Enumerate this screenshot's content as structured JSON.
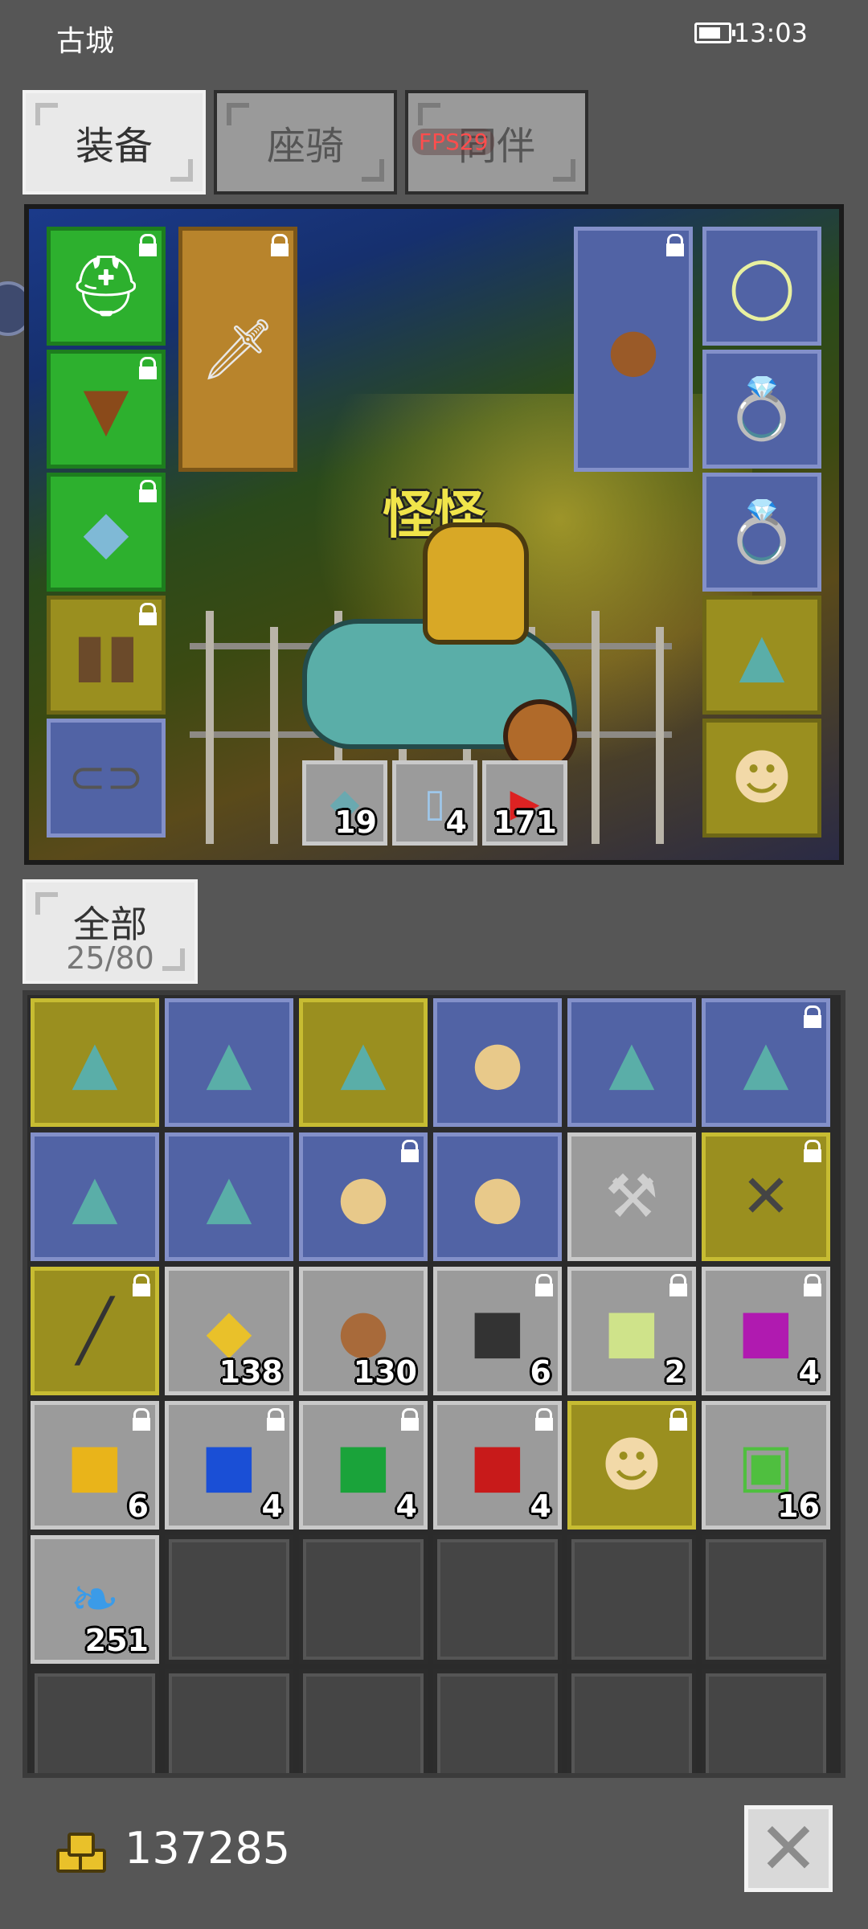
{
  "status_bar": {
    "location": "古城",
    "time": "13:03"
  },
  "tabs": [
    {
      "label": "装备",
      "active": true
    },
    {
      "label": "座骑",
      "active": false
    },
    {
      "label": "同伴",
      "active": false
    }
  ],
  "fps_label": "FPS29",
  "hero": {
    "name": "怪怪"
  },
  "equipment_slots": [
    {
      "name": "helmet-slot",
      "icon": "golden-helmet",
      "locked": true,
      "color": "green"
    },
    {
      "name": "armor-slot",
      "icon": "leather-armor",
      "locked": true,
      "color": "green"
    },
    {
      "name": "gloves-slot",
      "icon": "blue-bracer",
      "locked": true,
      "color": "green"
    },
    {
      "name": "boots-slot",
      "icon": "leather-boots",
      "locked": true,
      "color": "olive"
    },
    {
      "name": "belt-slot",
      "icon": "belt",
      "locked": false,
      "color": "blue"
    },
    {
      "name": "weapon-slot",
      "icon": "sword",
      "locked": true,
      "color": "brown"
    },
    {
      "name": "shield-slot",
      "icon": "round-shield",
      "locked": true,
      "color": "blue"
    },
    {
      "name": "amulet-slot",
      "icon": "amulet",
      "locked": false,
      "color": "blue"
    },
    {
      "name": "ring-slot-1",
      "icon": "emerald-ring",
      "locked": false,
      "color": "blue"
    },
    {
      "name": "ring-slot-2",
      "icon": "onyx-ring",
      "locked": false,
      "color": "blue"
    },
    {
      "name": "mount-slot",
      "icon": "dragon-mount-card",
      "locked": false,
      "color": "olive"
    },
    {
      "name": "companion-slot",
      "icon": "cat-companion",
      "locked": false,
      "color": "olive"
    }
  ],
  "quickbar": [
    {
      "icon": "fish",
      "count": "19"
    },
    {
      "icon": "scroll",
      "count": "4"
    },
    {
      "icon": "red-potion",
      "count": "171"
    }
  ],
  "filter": {
    "label": "全部",
    "capacity": "25/80"
  },
  "inventory": [
    {
      "icon": "dragon-card",
      "color": "olive",
      "locked": false,
      "count": ""
    },
    {
      "icon": "dragon-card",
      "color": "blue",
      "locked": false,
      "count": ""
    },
    {
      "icon": "dragon-card",
      "color": "olive",
      "locked": false,
      "count": ""
    },
    {
      "icon": "egg",
      "color": "blue",
      "locked": false,
      "count": ""
    },
    {
      "icon": "dragon-card",
      "color": "blue",
      "locked": false,
      "count": ""
    },
    {
      "icon": "dragon-card",
      "color": "blue",
      "locked": true,
      "count": ""
    },
    {
      "icon": "dragon-card",
      "color": "blue",
      "locked": false,
      "count": ""
    },
    {
      "icon": "dragon-card",
      "color": "blue",
      "locked": false,
      "count": ""
    },
    {
      "icon": "egg",
      "color": "blue",
      "locked": true,
      "count": ""
    },
    {
      "icon": "egg",
      "color": "blue",
      "locked": false,
      "count": ""
    },
    {
      "icon": "axe",
      "color": "gray",
      "locked": false,
      "count": ""
    },
    {
      "icon": "crossed-spears",
      "color": "olive",
      "locked": true,
      "count": ""
    },
    {
      "icon": "spear",
      "color": "olive",
      "locked": true,
      "count": ""
    },
    {
      "icon": "gold-nuggets",
      "color": "gray",
      "locked": false,
      "count": "138"
    },
    {
      "icon": "copper-ore",
      "color": "gray",
      "locked": false,
      "count": "130"
    },
    {
      "icon": "black-gem",
      "color": "gray",
      "locked": true,
      "count": "6"
    },
    {
      "icon": "lime-gem",
      "color": "gray",
      "locked": true,
      "count": "2"
    },
    {
      "icon": "purple-gem",
      "color": "gray",
      "locked": true,
      "count": "4"
    },
    {
      "icon": "yellow-gem",
      "color": "gray",
      "locked": true,
      "count": "6"
    },
    {
      "icon": "blue-gem",
      "color": "gray",
      "locked": true,
      "count": "4"
    },
    {
      "icon": "green-gem",
      "color": "gray",
      "locked": true,
      "count": "4"
    },
    {
      "icon": "red-gem",
      "color": "gray",
      "locked": true,
      "count": "4"
    },
    {
      "icon": "creature-card",
      "color": "olive",
      "locked": true,
      "count": ""
    },
    {
      "icon": "green-shell",
      "color": "gray",
      "locked": false,
      "count": "16"
    },
    {
      "icon": "blue-feather",
      "color": "gray",
      "locked": false,
      "count": "251"
    }
  ],
  "empty_slots": 17,
  "gold": "137285"
}
